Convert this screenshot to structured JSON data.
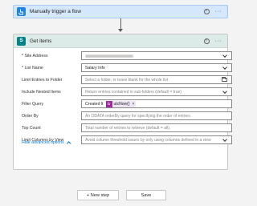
{
  "trigger": {
    "title": "Manually trigger a flow",
    "help": "?",
    "more": "···"
  },
  "action": {
    "icon_text": "S",
    "title": "Get items",
    "help": "?",
    "more": "···"
  },
  "fields": [
    {
      "label": "* Site Address",
      "value": "",
      "placeholder": "",
      "redacted": true,
      "control": "dropdown"
    },
    {
      "label": "* List Name",
      "value": "Salary Info",
      "placeholder": "",
      "redacted": false,
      "control": "dropdown"
    },
    {
      "label": "Limit Entries to Folder",
      "value": "",
      "placeholder": "Select a folder, or leave blank for the whole list",
      "redacted": false,
      "control": "folder"
    },
    {
      "label": "Include Nested Items",
      "value": "",
      "placeholder": "Return entries contained in sub-folders (default = true)",
      "redacted": false,
      "control": "dropdown"
    },
    {
      "label": "Filter Query",
      "value": "Created lt",
      "placeholder": "",
      "redacted": false,
      "control": "token"
    },
    {
      "label": "Order By",
      "value": "",
      "placeholder": "An ODATA orderBy query for specifying the order of entries.",
      "redacted": false,
      "control": "none"
    },
    {
      "label": "Top Count",
      "value": "",
      "placeholder": "Total number of entries to retrieve (default = all).",
      "redacted": false,
      "control": "none"
    },
    {
      "label": "Limit Columns by View",
      "value": "",
      "placeholder": "Avoid column threshold issues by only using columns defined in a view",
      "redacted": false,
      "control": "dropdown"
    }
  ],
  "filter_token": {
    "fx_label": "fx",
    "text": "utcNow()",
    "close": "×"
  },
  "hide_advanced": "Hide advanced options",
  "buttons": {
    "new_step": "+ New step",
    "save": "Save"
  },
  "colors": {
    "trigger_bg": "#d4e7fb",
    "action_header_bg": "#dceae8",
    "sharepoint": "#038387",
    "token_fx": "#9b2c9b",
    "link": "#0078d4"
  }
}
